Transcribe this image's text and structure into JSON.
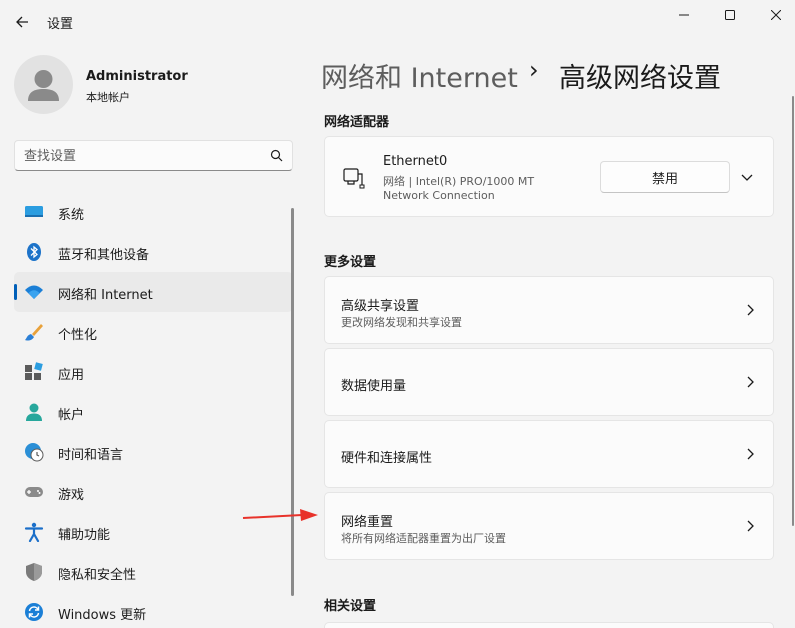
{
  "window": {
    "title": "设置",
    "controls": [
      "minimize-icon",
      "maximize-icon",
      "close-icon"
    ]
  },
  "profile": {
    "name": "Administrator",
    "account_type": "本地帐户"
  },
  "search": {
    "placeholder": "查找设置"
  },
  "sidebar": {
    "items": [
      {
        "label": "系统",
        "icon": "system-icon"
      },
      {
        "label": "蓝牙和其他设备",
        "icon": "bluetooth-icon"
      },
      {
        "label": "网络和 Internet",
        "icon": "wifi-icon",
        "selected": true
      },
      {
        "label": "个性化",
        "icon": "brush-icon"
      },
      {
        "label": "应用",
        "icon": "apps-icon"
      },
      {
        "label": "帐户",
        "icon": "account-icon"
      },
      {
        "label": "时间和语言",
        "icon": "time-language-icon"
      },
      {
        "label": "游戏",
        "icon": "gaming-icon"
      },
      {
        "label": "辅助功能",
        "icon": "accessibility-icon"
      },
      {
        "label": "隐私和安全性",
        "icon": "shield-icon"
      },
      {
        "label": "Windows 更新",
        "icon": "update-icon"
      }
    ]
  },
  "breadcrumb": {
    "parent": "网络和 Internet",
    "separator": "›",
    "current": "高级网络设置"
  },
  "adapters": {
    "section_title": "网络适配器",
    "items": [
      {
        "name": "Ethernet0",
        "description_line1": "网络 | Intel(R) PRO/1000 MT",
        "description_line2": "Network Connection",
        "button_label": "禁用"
      }
    ]
  },
  "more_settings": {
    "section_title": "更多设置",
    "items": [
      {
        "title": "高级共享设置",
        "subtitle": "更改网络发现和共享设置"
      },
      {
        "title": "数据使用量",
        "subtitle": ""
      },
      {
        "title": "硬件和连接属性",
        "subtitle": ""
      },
      {
        "title": "网络重置",
        "subtitle": "将所有网络适配器重置为出厂设置"
      }
    ]
  },
  "related_settings": {
    "section_title": "相关设置"
  },
  "colors": {
    "accent": "#005fb8",
    "annotation_arrow": "#e8322a",
    "background": "#f3f3f3",
    "card": "#fbfbfb"
  }
}
